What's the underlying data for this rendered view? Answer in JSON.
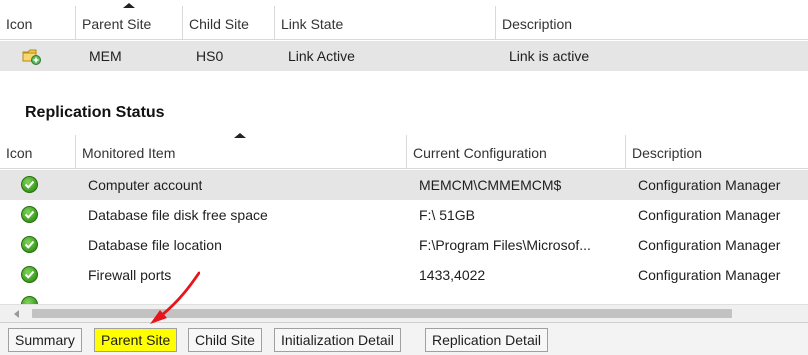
{
  "links_table": {
    "columns": [
      "Icon",
      "Parent Site",
      "Child Site",
      "Link State",
      "Description"
    ],
    "rows": [
      {
        "icon": "site-link-icon",
        "parent_site": "MEM",
        "child_site": "HS0",
        "link_state": "Link Active",
        "description": "Link is active"
      }
    ]
  },
  "replication": {
    "title": "Replication Status",
    "columns": [
      "Icon",
      "Monitored Item",
      "Current Configuration",
      "Description"
    ],
    "rows": [
      {
        "icon": "check-icon",
        "item": "Computer account",
        "config": "MEMCM\\CMMEMCM$",
        "description": "Configuration Manager"
      },
      {
        "icon": "check-icon",
        "item": "Database file disk free space",
        "config": "F:\\ 51GB",
        "description": "Configuration Manager"
      },
      {
        "icon": "check-icon",
        "item": "Database file location",
        "config": "F:\\Program Files\\Microsof...",
        "description": "Configuration Manager"
      },
      {
        "icon": "check-icon",
        "item": "Firewall ports",
        "config": "1433,4022",
        "description": "Configuration Manager"
      }
    ]
  },
  "tabs": [
    {
      "label": "Summary",
      "active": false
    },
    {
      "label": "Parent Site",
      "active": true
    },
    {
      "label": "Child Site",
      "active": false
    },
    {
      "label": "Initialization Detail",
      "active": false
    },
    {
      "label": "Replication Detail",
      "active": false
    }
  ],
  "colors": {
    "active_tab_highlight": "#ffff00",
    "annotation_arrow": "#e8141b",
    "status_ok": "#3a9a1e"
  }
}
